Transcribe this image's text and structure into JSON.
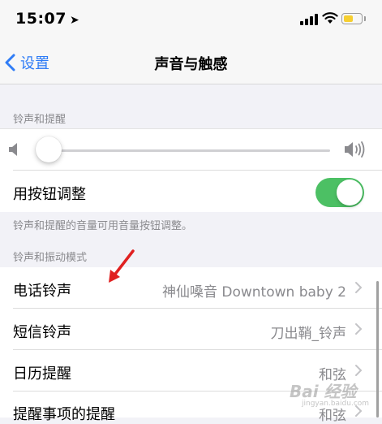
{
  "status_bar": {
    "time": "15:07",
    "location_icon": "location-arrow-icon",
    "signal_icon": "cellular-signal-icon",
    "wifi_icon": "wifi-icon",
    "battery_icon": "battery-icon",
    "battery_level": 0.55,
    "battery_color": "#f6cf31"
  },
  "nav": {
    "back_label": "设置",
    "title": "声音与触感",
    "accent": "#2f7cf6"
  },
  "ringer_section": {
    "header": "铃声和提醒",
    "volume_level": 0.03,
    "volume_low_icon": "speaker-low-icon",
    "volume_high_icon": "speaker-high-icon",
    "button_adjust_label": "用按钮调整",
    "button_adjust_on": true,
    "toggle_color": "#4cc064",
    "footer": "铃声和提醒的音量可用音量按钮调整。"
  },
  "patterns_section": {
    "header": "铃声和振动模式",
    "rows": [
      {
        "label": "电话铃声",
        "value": "神仙嗓音 Downtown baby 2"
      },
      {
        "label": "短信铃声",
        "value": "刀出鞘_铃声"
      },
      {
        "label": "日历提醒",
        "value": "和弦"
      },
      {
        "label": "提醒事项的提醒",
        "value": "和弦"
      }
    ]
  },
  "watermark": {
    "text": "Bai 经验",
    "sub": "jingyan.baidu.com"
  }
}
